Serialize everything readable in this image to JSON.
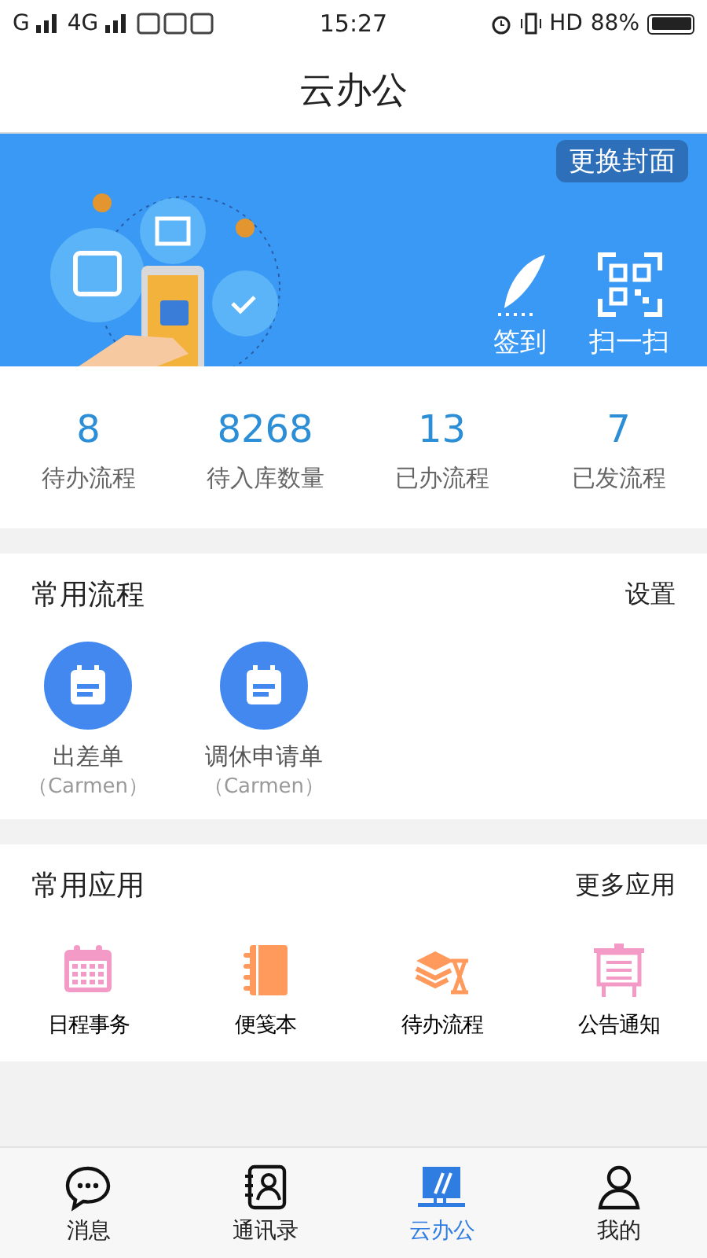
{
  "status_bar": {
    "left": [
      "G",
      "4G"
    ],
    "time": "15:27",
    "network": "HD",
    "battery": "88%"
  },
  "title": "云办公",
  "banner": {
    "cover_button": "更换封面",
    "actions": [
      {
        "kind": "sign",
        "label": "签到"
      },
      {
        "kind": "scan",
        "label": "扫一扫"
      }
    ]
  },
  "stats": [
    {
      "value": "8",
      "label": "待办流程"
    },
    {
      "value": "8268",
      "label": "待入库数量"
    },
    {
      "value": "13",
      "label": "已办流程"
    },
    {
      "value": "7",
      "label": "已发流程"
    }
  ],
  "flows": {
    "title": "常用流程",
    "action": "设置",
    "items": [
      {
        "name": "出差单",
        "owner": "（Carmen）"
      },
      {
        "name": "调休申请单",
        "owner": "（Carmen）"
      }
    ]
  },
  "apps": {
    "title": "常用应用",
    "action": "更多应用",
    "items": [
      {
        "kind": "calendar",
        "label": "日程事务"
      },
      {
        "kind": "notebook",
        "label": "便笺本"
      },
      {
        "kind": "hourglass",
        "label": "待办流程"
      },
      {
        "kind": "board",
        "label": "公告通知"
      }
    ]
  },
  "tabs": [
    {
      "kind": "chat",
      "label": "消息",
      "selected": false
    },
    {
      "kind": "contacts",
      "label": "通讯录",
      "selected": false
    },
    {
      "kind": "office",
      "label": "云办公",
      "selected": true
    },
    {
      "kind": "me",
      "label": "我的",
      "selected": false
    }
  ]
}
